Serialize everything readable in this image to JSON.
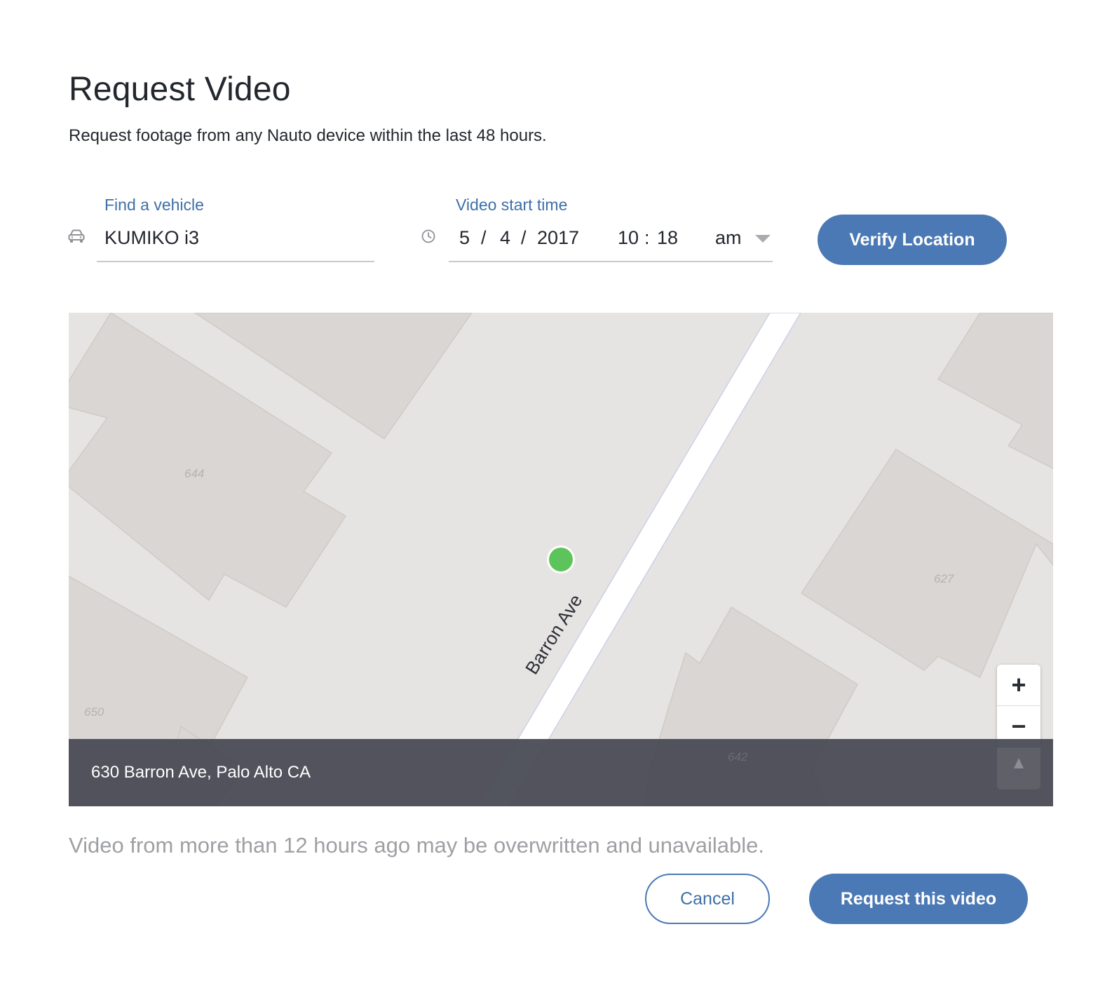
{
  "dialog": {
    "title": "Request Video",
    "subtitle": "Request footage from any Nauto device within the last 48 hours."
  },
  "vehicle_field": {
    "label": "Find a vehicle",
    "value": "KUMIKO i3",
    "icon": "car-icon"
  },
  "time_field": {
    "label": "Video start time",
    "month": "5",
    "day": "4",
    "year": "2017",
    "hour": "10",
    "minute": "18",
    "separator_date": "/",
    "separator_time": ":",
    "meridiem": "am",
    "icon": "clock-icon"
  },
  "verify_button": {
    "label": "Verify Location"
  },
  "map": {
    "street_name": "Barron Ave",
    "address": "630 Barron Ave, Palo Alto CA",
    "lot_numbers": [
      "644",
      "627",
      "650",
      "642"
    ],
    "marker_color": "#5cc45a",
    "zoom_in_label": "+",
    "zoom_out_label": "−"
  },
  "footnote": "Video from more than 12 hours ago may be overwritten and unavailable.",
  "actions": {
    "cancel_label": "Cancel",
    "request_label": "Request this video"
  },
  "colors": {
    "accent": "#4b79b5",
    "label_blue": "#3f6fa8",
    "address_bar": "#464852"
  }
}
